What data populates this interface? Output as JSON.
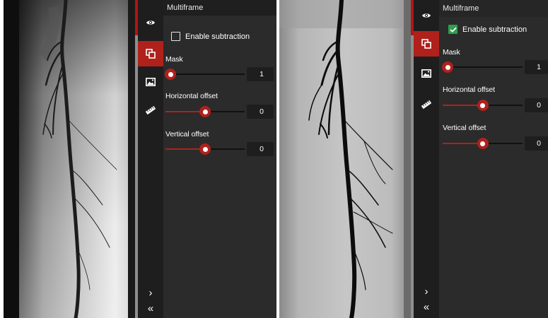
{
  "panels": [
    {
      "header": "Multiframe",
      "subtraction_label": "Enable subtraction",
      "subtraction_enabled": false,
      "mask_label": "Mask",
      "mask_value": "1",
      "mask_fraction": 0.0,
      "horizontal_label": "Horizontal offset",
      "horizontal_value": "0",
      "horizontal_fraction": 0.5,
      "vertical_label": "Vertical offset",
      "vertical_value": "0",
      "vertical_fraction": 0.5
    },
    {
      "header": "Multiframe",
      "subtraction_label": "Enable subtraction",
      "subtraction_enabled": true,
      "mask_label": "Mask",
      "mask_value": "1",
      "mask_fraction": 0.0,
      "horizontal_label": "Horizontal offset",
      "horizontal_value": "0",
      "horizontal_fraction": 0.5,
      "vertical_label": "Vertical offset",
      "vertical_value": "0",
      "vertical_fraction": 0.5
    }
  ],
  "toolbar_icons": [
    "eye-icon",
    "layers-icon",
    "image-icon",
    "ruler-icon"
  ],
  "nav": {
    "expand": "›",
    "collapse": "«"
  },
  "colors": {
    "accent": "#b0211c",
    "check": "#2e9e4f",
    "panel_bg": "#2b2b2b",
    "iconbar_bg": "#1e1e1e"
  }
}
